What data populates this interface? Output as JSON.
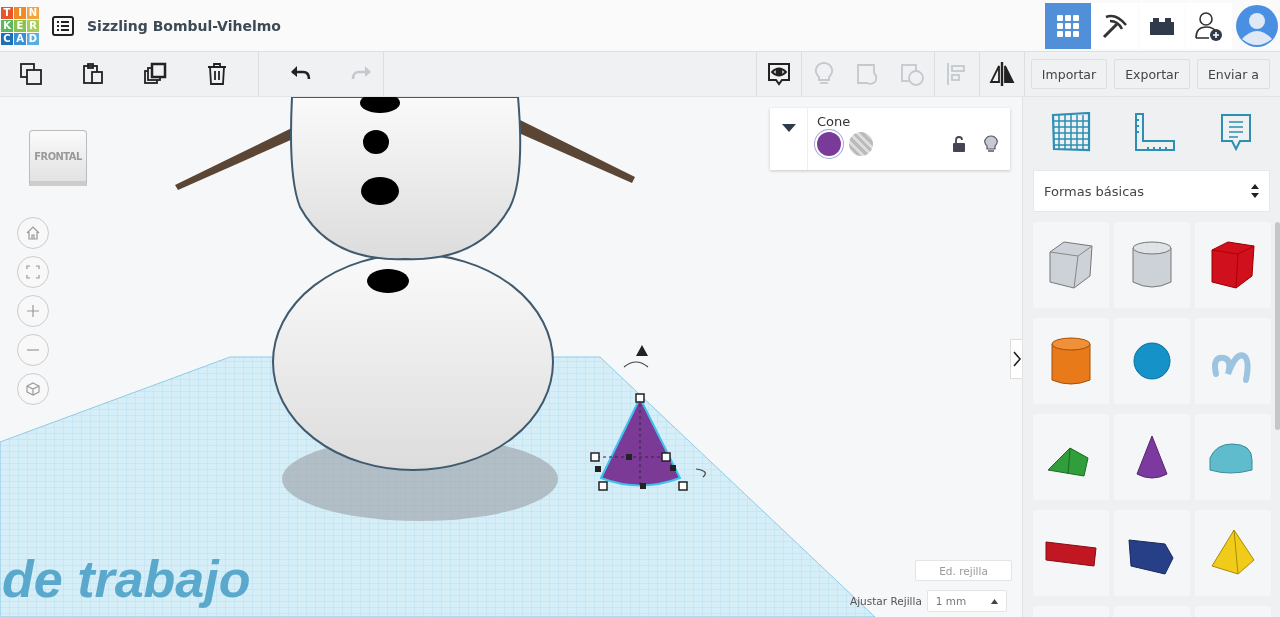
{
  "logo": [
    "T",
    "I",
    "N",
    "K",
    "E",
    "R",
    "C",
    "A",
    "D"
  ],
  "title": "Sizzling Bombul-Vihelmo",
  "view_modes": [
    {
      "kind": "grid",
      "selected": true
    },
    {
      "kind": "pickaxe",
      "selected": false
    },
    {
      "kind": "bricks",
      "selected": false
    }
  ],
  "edit_tools": [
    {
      "kind": "copy",
      "disabled": false
    },
    {
      "kind": "paste",
      "disabled": false
    },
    {
      "kind": "duplicate",
      "disabled": false
    },
    {
      "kind": "delete",
      "disabled": false
    },
    {
      "kind": "undo",
      "disabled": false
    },
    {
      "kind": "redo",
      "disabled": true
    }
  ],
  "shape_tools": [
    {
      "kind": "notes",
      "disabled": false
    },
    {
      "kind": "light",
      "disabled": true
    },
    {
      "kind": "group",
      "disabled": true
    },
    {
      "kind": "ungroup",
      "disabled": true
    },
    {
      "kind": "align",
      "disabled": true
    },
    {
      "kind": "mirror",
      "disabled": false
    }
  ],
  "actions": [
    "Importar",
    "Exportar",
    "Enviar a"
  ],
  "view_cube": "FRONTAL",
  "inspector": {
    "name": "Cone",
    "swatches": [
      {
        "kind": "solid",
        "selected": true
      },
      {
        "kind": "hole",
        "selected": false
      }
    ]
  },
  "library": {
    "category": "Formas básicas"
  },
  "grid": {
    "edit_label": "Ed. rejilla",
    "snap_label": "Ajustar Rejilla",
    "snap_value": "1 mm"
  },
  "workplane_label": "de trabajo"
}
